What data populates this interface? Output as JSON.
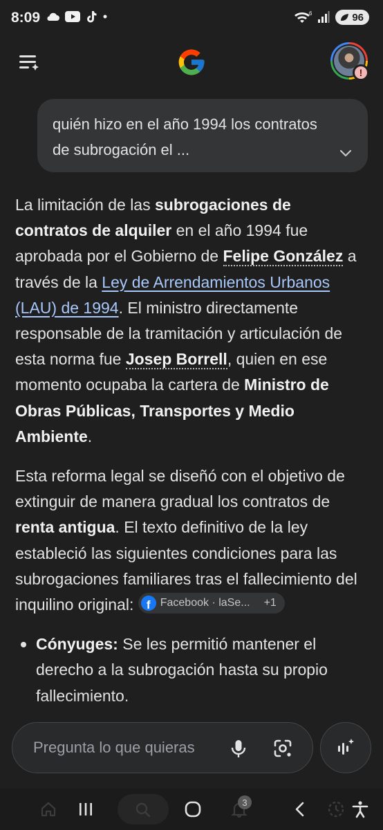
{
  "status_bar": {
    "time": "8:09",
    "left_icons": [
      "cloud-icon",
      "youtube-icon",
      "tiktok-icon",
      "dot-icon"
    ],
    "network_label": "6",
    "battery_level": "96"
  },
  "app_bar": {
    "menu_icon": "menu-sparkle-icon",
    "logo": "google-g-logo",
    "avatar_alert": "!"
  },
  "query": {
    "text": "quién hizo en el año 1994 los contratos de subrogación el ..."
  },
  "answer": {
    "p1": {
      "t1": "La limitación de las ",
      "b1": "subrogaciones de contratos de alquiler",
      "t2": " en el año 1994 fue aprobada por el Gobierno de ",
      "e1": "Felipe González",
      "t3": " a través de la ",
      "link": "Ley de Arrendamientos Urbanos (LAU) de 1994",
      "t4": ". El ministro directamente responsable de la tramitación y articulación de esta norma fue ",
      "e2": "Josep Borrell",
      "t5": ", quien en ese momento ocupaba la cartera de ",
      "b2": "Ministro de Obras Públicas, Transportes y Medio Ambiente",
      "t6": "."
    },
    "p2": {
      "t1": "Esta reforma legal se diseñó con el objetivo de extinguir de manera gradual los contratos de ",
      "b1": "renta antigua",
      "t2": ". El texto definitivo de la ley estableció las siguientes condiciones para las subrogaciones familiares tras el fallecimiento del inquilino original: "
    },
    "source_chip": {
      "icon": "facebook-icon",
      "label": "Facebook · laSe...",
      "extra": "+1"
    },
    "bullets": [
      {
        "bold": "Cónyuges:",
        "text": " Se les permitió mantener el derecho a la subrogación hasta su propio fallecimiento."
      }
    ]
  },
  "input": {
    "placeholder": "Pregunta lo que quieras",
    "mic_icon": "mic-icon",
    "lens_icon": "lens-icon",
    "ai_icon": "ai-mode-icon"
  },
  "nav_bar": {
    "items": [
      "home-icon",
      "recents-icon",
      "search-icon",
      "home-circle-icon",
      "notifications-icon",
      "back-icon",
      "activity-icon",
      "accessibility-icon"
    ],
    "notification_count": "3"
  }
}
